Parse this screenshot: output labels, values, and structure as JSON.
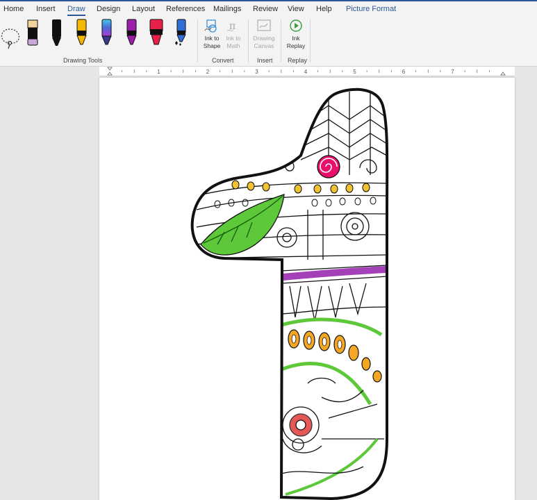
{
  "tabs": {
    "home": "Home",
    "insert": "Insert",
    "draw": "Draw",
    "design": "Design",
    "layout": "Layout",
    "references": "References",
    "mailings": "Mailings",
    "review": "Review",
    "view": "View",
    "help": "Help",
    "picture_format": "Picture Format",
    "active": "Draw"
  },
  "ribbon": {
    "groups": {
      "drawing_tools": "Drawing Tools",
      "convert": "Convert",
      "insert": "Insert",
      "replay": "Replay"
    },
    "tools": {
      "lasso": "lasso-select-icon",
      "pens": [
        {
          "icon": "highlighter-icon",
          "color": "#f3d19b",
          "tip": "#c9a6d8"
        },
        {
          "icon": "pen-icon",
          "color": "#111111"
        },
        {
          "icon": "pen-icon",
          "color": "#f5b800"
        },
        {
          "icon": "galaxy-pen-icon",
          "color": "#4a6ad8"
        },
        {
          "icon": "pen-icon",
          "color": "#9b1fa8"
        },
        {
          "icon": "highlighter-icon",
          "color": "#e8204a"
        },
        {
          "icon": "sparkle-pen-icon",
          "color": "#2f6fd6"
        }
      ]
    },
    "ink_to_shape": {
      "line1": "Ink to",
      "line2": "Shape"
    },
    "ink_to_math": {
      "line1": "Ink to",
      "line2": "Math"
    },
    "drawing_canvas": {
      "line1": "Drawing",
      "line2": "Canvas"
    },
    "ink_replay": {
      "line1": "Ink",
      "line2": "Replay"
    }
  },
  "ruler": {
    "numbers": [
      "1",
      "2",
      "3",
      "4",
      "5",
      "6",
      "7"
    ]
  },
  "document": {
    "image": "zentangle-number-one-coloring-page",
    "ink_colors": {
      "outline": "#111111",
      "magenta": "#e8106a",
      "green": "#5cc83a",
      "purple": "#9a2bb0",
      "orange": "#f5a623",
      "yellow": "#f2c230",
      "red": "#e23a3a"
    }
  }
}
